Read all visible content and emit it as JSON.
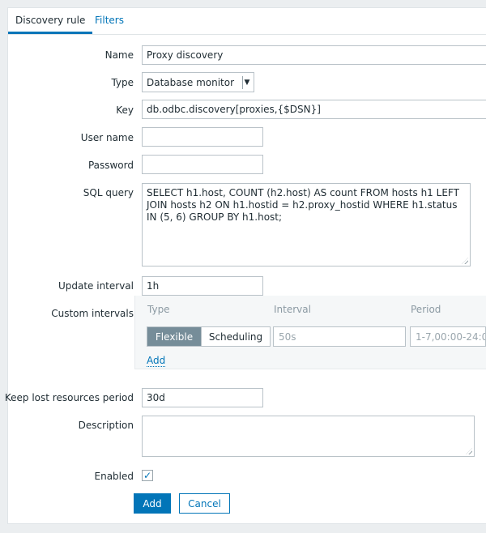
{
  "tabs": [
    {
      "label": "Discovery rule"
    },
    {
      "label": "Filters"
    }
  ],
  "form": {
    "name": {
      "label": "Name",
      "value": "Proxy discovery"
    },
    "type": {
      "label": "Type",
      "value": "Database monitor"
    },
    "key": {
      "label": "Key",
      "value": "db.odbc.discovery[proxies,{$DSN}]"
    },
    "username": {
      "label": "User name",
      "value": ""
    },
    "password": {
      "label": "Password",
      "value": ""
    },
    "sql_query": {
      "label": "SQL query",
      "value": "SELECT h1.host, COUNT (h2.host) AS count FROM hosts h1 LEFT JOIN hosts h2 ON h1.hostid = h2.proxy_hostid WHERE h1.status IN (5, 6) GROUP BY h1.host;"
    },
    "update_interval": {
      "label": "Update interval",
      "value": "1h"
    },
    "custom_intervals": {
      "label": "Custom intervals",
      "col_type": "Type",
      "col_interval": "Interval",
      "col_period": "Period",
      "mode_flexible": "Flexible",
      "mode_scheduling": "Scheduling",
      "interval_placeholder": "50s",
      "period_placeholder": "1-7,00:00-24:00",
      "add_label": "Add"
    },
    "keep_lost": {
      "label": "Keep lost resources period",
      "value": "30d"
    },
    "description": {
      "label": "Description",
      "value": ""
    },
    "enabled": {
      "label": "Enabled",
      "checked": true
    }
  },
  "buttons": {
    "add": "Add",
    "cancel": "Cancel"
  }
}
